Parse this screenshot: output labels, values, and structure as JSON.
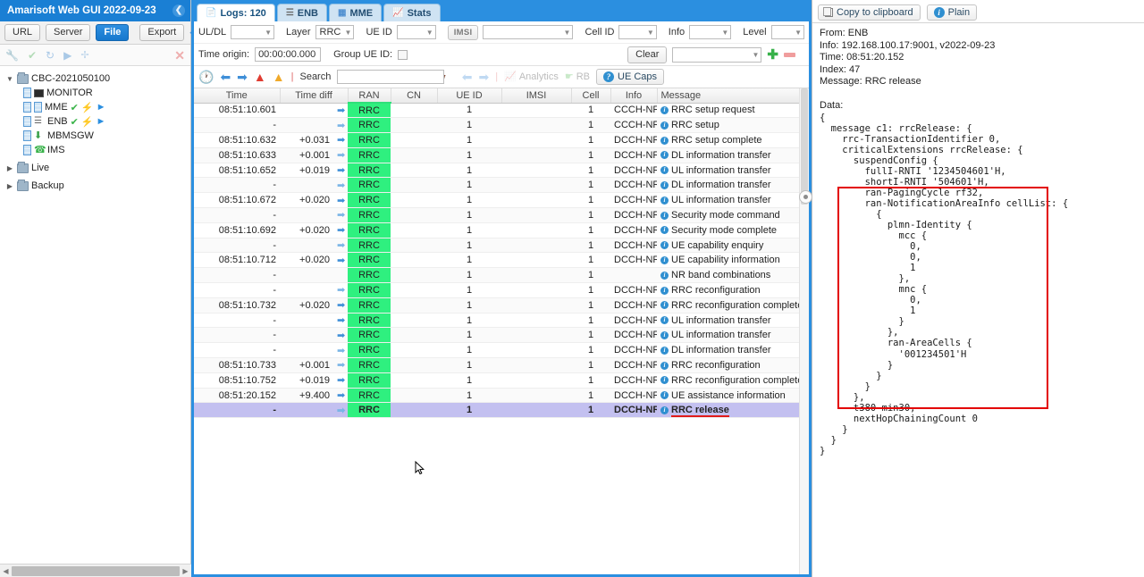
{
  "app": {
    "title": "Amarisoft Web GUI 2022-09-23",
    "collapse_icon": "chevron-left-icon"
  },
  "left_panel": {
    "buttons": [
      {
        "label": "URL",
        "active": false
      },
      {
        "label": "Server",
        "active": false
      },
      {
        "label": "File",
        "active": true
      }
    ],
    "export_label": "Export",
    "export_icon": "connect-icon",
    "icon_bar": [
      "wrench-icon",
      "check-circle-icon",
      "refresh-icon",
      "play-circle-icon",
      "connect-icon"
    ],
    "close_icon": "close-icon",
    "tree": [
      {
        "label": "CBC-2021050100",
        "type": "folder",
        "expanded": true,
        "indent": 0,
        "badges": []
      },
      {
        "label": "MONITOR",
        "type": "node",
        "indent": 1,
        "badges": []
      },
      {
        "label": "MME",
        "type": "node",
        "indent": 1,
        "badges": [
          "ok",
          "bolt",
          "play"
        ]
      },
      {
        "label": "ENB",
        "type": "node",
        "indent": 1,
        "badges": [
          "ok",
          "bolt",
          "play"
        ]
      },
      {
        "label": "MBMSGW",
        "type": "node",
        "indent": 1,
        "badges": []
      },
      {
        "label": "IMS",
        "type": "node",
        "indent": 1,
        "badges": []
      },
      {
        "label": "Live",
        "type": "folder",
        "expanded": false,
        "indent": 0,
        "badges": []
      },
      {
        "label": "Backup",
        "type": "folder",
        "expanded": false,
        "indent": 0,
        "badges": []
      }
    ]
  },
  "tabs": [
    {
      "label": "Logs: 120",
      "icon": "document-icon",
      "selected": true
    },
    {
      "label": "ENB",
      "icon": "antenna-icon",
      "selected": false
    },
    {
      "label": "MME",
      "icon": "server-icon",
      "selected": false
    },
    {
      "label": "Stats",
      "icon": "bar-chart-icon",
      "selected": false
    }
  ],
  "filters": {
    "uldl_label": "UL/DL",
    "uldl_value": "",
    "layer_label": "Layer",
    "layer_value": "RRC",
    "ueid_label": "UE ID",
    "ueid_value": "",
    "imsi_label": "IMSI",
    "imsi_value": "",
    "cellid_label": "Cell ID",
    "cellid_value": "",
    "info_label": "Info",
    "info_value": "",
    "level_label": "Level",
    "level_value": "",
    "time_origin_label": "Time origin:",
    "time_origin_value": "00:00:00.000",
    "group_ueid_label": "Group UE ID:",
    "group_ueid_checked": false,
    "clear_label": "Clear",
    "preset_value": "",
    "add_icon": "plus-icon",
    "remove_icon": "minus-icon"
  },
  "log_toolbar": {
    "icons": [
      "clock-icon",
      "arrow-left-icon",
      "arrow-right-icon",
      "error-icon",
      "warning-icon"
    ],
    "search_label": "Search",
    "search_value": "",
    "binoculars_icon": "binoculars-icon",
    "prev_icon": "arrow-left-icon",
    "next_icon": "arrow-right-icon",
    "analytics_label": "Analytics",
    "analytics_icon": "bar-chart-icon",
    "rb_label": "RB",
    "rb_icon": "puzzle-icon",
    "uecaps_label": "UE Caps",
    "uecaps_icon": "question-icon"
  },
  "table": {
    "columns": [
      "Time",
      "Time diff",
      "RAN",
      "CN",
      "UE ID",
      "IMSI",
      "Cell",
      "Info",
      "Message"
    ],
    "sorted_column": "RAN",
    "rows": [
      {
        "time": "08:51:10.601",
        "diff": "",
        "dir": "dl",
        "ran": "RRC",
        "cn": "",
        "ueid": "1",
        "imsi": "",
        "cell": "1",
        "info": "CCCH-NR",
        "message": "RRC setup request"
      },
      {
        "time": "-",
        "diff": "",
        "dir": "ul",
        "ran": "RRC",
        "cn": "",
        "ueid": "1",
        "imsi": "",
        "cell": "1",
        "info": "CCCH-NR",
        "message": "RRC setup"
      },
      {
        "time": "08:51:10.632",
        "diff": "+0.031",
        "dir": "dl",
        "ran": "RRC",
        "cn": "",
        "ueid": "1",
        "imsi": "",
        "cell": "1",
        "info": "DCCH-NR",
        "message": "RRC setup complete"
      },
      {
        "time": "08:51:10.633",
        "diff": "+0.001",
        "dir": "ul",
        "ran": "RRC",
        "cn": "",
        "ueid": "1",
        "imsi": "",
        "cell": "1",
        "info": "DCCH-NR",
        "message": "DL information transfer"
      },
      {
        "time": "08:51:10.652",
        "diff": "+0.019",
        "dir": "dl",
        "ran": "RRC",
        "cn": "",
        "ueid": "1",
        "imsi": "",
        "cell": "1",
        "info": "DCCH-NR",
        "message": "UL information transfer"
      },
      {
        "time": "-",
        "diff": "",
        "dir": "ul",
        "ran": "RRC",
        "cn": "",
        "ueid": "1",
        "imsi": "",
        "cell": "1",
        "info": "DCCH-NR",
        "message": "DL information transfer"
      },
      {
        "time": "08:51:10.672",
        "diff": "+0.020",
        "dir": "dl",
        "ran": "RRC",
        "cn": "",
        "ueid": "1",
        "imsi": "",
        "cell": "1",
        "info": "DCCH-NR",
        "message": "UL information transfer"
      },
      {
        "time": "-",
        "diff": "",
        "dir": "ul",
        "ran": "RRC",
        "cn": "",
        "ueid": "1",
        "imsi": "",
        "cell": "1",
        "info": "DCCH-NR",
        "message": "Security mode command"
      },
      {
        "time": "08:51:10.692",
        "diff": "+0.020",
        "dir": "dl",
        "ran": "RRC",
        "cn": "",
        "ueid": "1",
        "imsi": "",
        "cell": "1",
        "info": "DCCH-NR",
        "message": "Security mode complete"
      },
      {
        "time": "-",
        "diff": "",
        "dir": "ul",
        "ran": "RRC",
        "cn": "",
        "ueid": "1",
        "imsi": "",
        "cell": "1",
        "info": "DCCH-NR",
        "message": "UE capability enquiry"
      },
      {
        "time": "08:51:10.712",
        "diff": "+0.020",
        "dir": "dl",
        "ran": "RRC",
        "cn": "",
        "ueid": "1",
        "imsi": "",
        "cell": "1",
        "info": "DCCH-NR",
        "message": "UE capability information"
      },
      {
        "time": "-",
        "diff": "",
        "dir": "",
        "ran": "RRC",
        "cn": "",
        "ueid": "1",
        "imsi": "",
        "cell": "1",
        "info": "",
        "message": "NR band combinations"
      },
      {
        "time": "-",
        "diff": "",
        "dir": "ul",
        "ran": "RRC",
        "cn": "",
        "ueid": "1",
        "imsi": "",
        "cell": "1",
        "info": "DCCH-NR",
        "message": "RRC reconfiguration"
      },
      {
        "time": "08:51:10.732",
        "diff": "+0.020",
        "dir": "dl",
        "ran": "RRC",
        "cn": "",
        "ueid": "1",
        "imsi": "",
        "cell": "1",
        "info": "DCCH-NR",
        "message": "RRC reconfiguration complete"
      },
      {
        "time": "-",
        "diff": "",
        "dir": "dl",
        "ran": "RRC",
        "cn": "",
        "ueid": "1",
        "imsi": "",
        "cell": "1",
        "info": "DCCH-NR",
        "message": "UL information transfer"
      },
      {
        "time": "-",
        "diff": "",
        "dir": "dl",
        "ran": "RRC",
        "cn": "",
        "ueid": "1",
        "imsi": "",
        "cell": "1",
        "info": "DCCH-NR",
        "message": "UL information transfer"
      },
      {
        "time": "-",
        "diff": "",
        "dir": "ul",
        "ran": "RRC",
        "cn": "",
        "ueid": "1",
        "imsi": "",
        "cell": "1",
        "info": "DCCH-NR",
        "message": "DL information transfer"
      },
      {
        "time": "08:51:10.733",
        "diff": "+0.001",
        "dir": "ul",
        "ran": "RRC",
        "cn": "",
        "ueid": "1",
        "imsi": "",
        "cell": "1",
        "info": "DCCH-NR",
        "message": "RRC reconfiguration"
      },
      {
        "time": "08:51:10.752",
        "diff": "+0.019",
        "dir": "dl",
        "ran": "RRC",
        "cn": "",
        "ueid": "1",
        "imsi": "",
        "cell": "1",
        "info": "DCCH-NR",
        "message": "RRC reconfiguration complete"
      },
      {
        "time": "08:51:20.152",
        "diff": "+9.400",
        "dir": "dl",
        "ran": "RRC",
        "cn": "",
        "ueid": "1",
        "imsi": "",
        "cell": "1",
        "info": "DCCH-NR",
        "message": "UE assistance information"
      },
      {
        "time": "-",
        "diff": "",
        "dir": "ul",
        "ran": "RRC",
        "cn": "",
        "ueid": "1",
        "imsi": "",
        "cell": "1",
        "info": "DCCH-NR",
        "message": "RRC release",
        "selected": true,
        "underline": true
      }
    ]
  },
  "detail": {
    "copy_label": "Copy to clipboard",
    "copy_icon": "copy-icon",
    "plain_label": "Plain",
    "plain_icon": "info-icon",
    "meta": [
      "From: ENB",
      "Info: 192.168.100.17:9001, v2022-09-23",
      "Time: 08:51:20.152",
      "Index: 47",
      "Message: RRC release",
      "",
      "Data:"
    ],
    "asn_text": "{\n  message c1: rrcRelease: {\n    rrc-TransactionIdentifier 0,\n    criticalExtensions rrcRelease: {\n      suspendConfig {\n        fullI-RNTI '1234504601'H,\n        shortI-RNTI '504601'H,\n        ran-PagingCycle rf32,\n        ran-NotificationAreaInfo cellList: {\n          {\n            plmn-Identity {\n              mcc {\n                0,\n                0,\n                1\n              },\n              mnc {\n                0,\n                1\n              }\n            },\n            ran-AreaCells {\n              '001234501'H\n            }\n          }\n        }\n      },\n      t380 min30,\n      nextHopChainingCount 0\n    }\n  }\n}",
    "highlight_box": {
      "color": "#e30000"
    }
  },
  "colors": {
    "brand_blue": "#1a7fd4",
    "ran_green": "#2ff07f",
    "selected_row": "#c3c0f0",
    "highlight_red": "#e30000"
  }
}
